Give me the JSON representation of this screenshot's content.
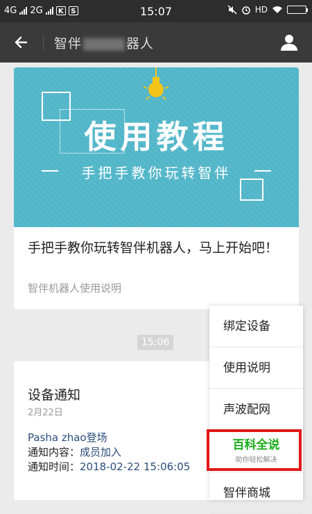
{
  "status_bar": {
    "network_1": "4G",
    "network_2": "2G",
    "app_badge_1": "K",
    "app_badge_2": "S",
    "time": "15:07",
    "hd": "HD"
  },
  "nav": {
    "title_prefix": "智伴",
    "title_suffix": "器人"
  },
  "tutorial_card": {
    "banner_title": "使用教程",
    "banner_subtitle": "手把手教你玩转智伴",
    "title": "手把手教你玩转智伴机器人，马上开始吧！",
    "subtitle": "智伴机器人使用说明"
  },
  "time_tag": "15:06",
  "notice_card": {
    "title": "设备通知",
    "date": "2月22日",
    "line1": "Pasha zhao登场",
    "content_label": "通知内容：",
    "content_value": "成员加入",
    "time_label": "通知时间：",
    "time_value": "2018-02-22 15:06:05"
  },
  "menu": {
    "items": [
      {
        "label": "绑定设备"
      },
      {
        "label": "使用说明"
      },
      {
        "label": "声波配网"
      },
      {
        "label": "百科全说",
        "sub": "助你轻松解决"
      },
      {
        "label": "智伴商城"
      }
    ]
  },
  "colors": {
    "banner": "#52b6c9",
    "highlight_green": "#1aad19",
    "annotation_red": "#e01818"
  }
}
